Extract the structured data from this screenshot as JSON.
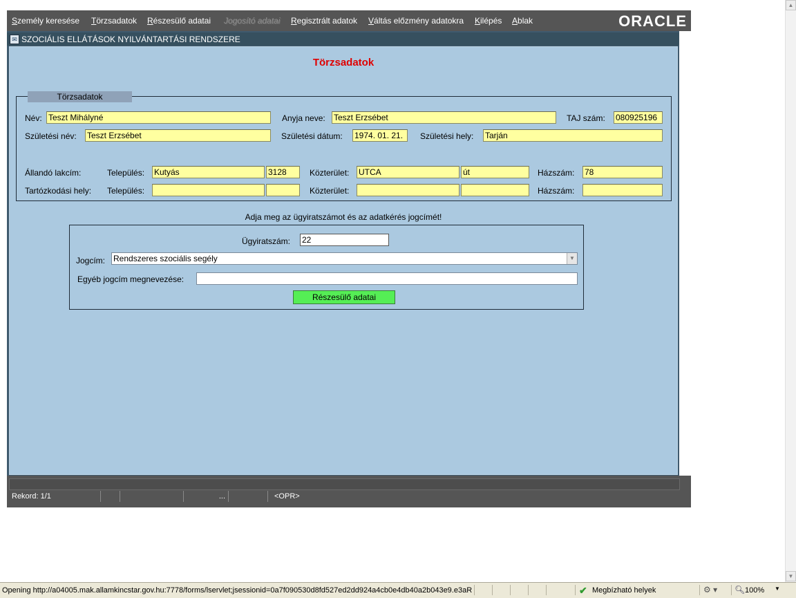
{
  "menu": {
    "items": [
      {
        "u": "S",
        "rest": "zemély keresése"
      },
      {
        "u": "T",
        "rest": "örzsadatok"
      },
      {
        "u": "R",
        "rest": "észesülő adatai"
      },
      {
        "u": "",
        "rest": "Jogosító adatai"
      },
      {
        "u": "R",
        "rest": "egisztrált adatok"
      },
      {
        "u": "V",
        "rest": "áltás előzmény adatokra"
      },
      {
        "u": "K",
        "rest": "ilépés"
      },
      {
        "u": "A",
        "rest": "blak"
      }
    ],
    "logo": "ORACLE"
  },
  "window": {
    "title": "SZOCIÁLIS ELLÁTÁSOK NYILVÁNTARTÁSI RENDSZERE",
    "page_title": "Törzsadatok"
  },
  "torzs": {
    "group_title": "Törzsadatok",
    "nev_label": "Név:",
    "nev": "Teszt Mihályné",
    "anyja_label": "Anyja neve:",
    "anyja": "Teszt Erzsébet",
    "taj_label": "TAJ szám:",
    "taj": "080925196",
    "szulnev_label": "Születési név:",
    "szulnev": "Teszt Erzsébet",
    "szuldatum_label": "Születési dátum:",
    "szuldatum": "1974. 01. 21.",
    "szulhely_label": "Születési hely:",
    "szulhely": "Tarján",
    "allando_label": "Állandó lakcím:",
    "tartozkodasi_label": "Tartózkodási hely:",
    "telepules_label": "Település:",
    "kozterulet_label": "Közterület:",
    "hazszam_label": "Házszám:",
    "allando": {
      "telepules": "Kutyás",
      "irsz": "3128",
      "kozterulet": "UTCA",
      "jelleg": "út",
      "hazszam": "78"
    },
    "tartozkodasi": {
      "telepules": "",
      "irsz": "",
      "kozterulet": "",
      "jelleg": "",
      "hazszam": ""
    }
  },
  "request": {
    "prompt": "Adja meg az ügyiratszámot és az adatkérés jogcímét!",
    "ugyirat_label": "Ügyiratszám:",
    "ugyirat": "22",
    "jogcim_label": "Jogcím:",
    "jogcim": "Rendszeres szociális segély",
    "egyeb_label": "Egyéb jogcím megnevezése:",
    "egyeb": "",
    "button": "Részesülő adatai"
  },
  "status": {
    "record": "Rekord: 1/1",
    "ellipsis": "...",
    "mode": "<OPR>"
  },
  "browser_status": {
    "text": "Opening http://a04005.mak.allamkincstar.gov.hu:7778/forms/lservlet;jsessionid=0a7f090530d8fd527ed2dd924a4cb0e4db40a2b043e9.e3aR",
    "zone": "Megbízható helyek",
    "zoom": "100%"
  },
  "colors": {
    "menubar": "#555555",
    "content_bg": "#abc9e0",
    "field_bg": "#ffffa0",
    "title_red": "#e00000",
    "button_green": "#55ee55"
  }
}
